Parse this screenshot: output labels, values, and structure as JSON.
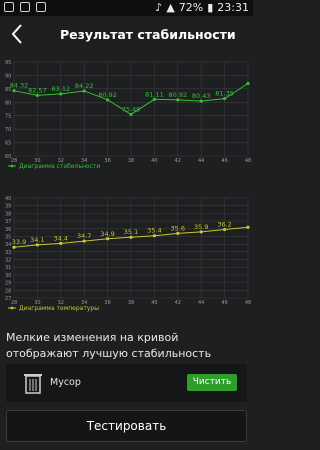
{
  "status_bar": {
    "battery": "72%",
    "time": "23:31"
  },
  "header": {
    "title": "Результат стабильности"
  },
  "stability_chart": {
    "legend": "Диаграмма стабильности",
    "y_ticks": [
      "60",
      "65",
      "70",
      "75",
      "80",
      "85",
      "90",
      "95"
    ],
    "x_ticks": [
      "28",
      "30",
      "32",
      "34",
      "36",
      "38",
      "40",
      "42",
      "44",
      "46",
      "48"
    ]
  },
  "temperature_chart": {
    "legend": "Диаграмма температуры",
    "y_ticks": [
      "27",
      "28",
      "29",
      "30",
      "31",
      "32",
      "33",
      "34",
      "35",
      "36",
      "37",
      "38",
      "39",
      "40"
    ],
    "x_ticks": [
      "28",
      "30",
      "32",
      "34",
      "36",
      "38",
      "40",
      "42",
      "44",
      "46",
      "48"
    ]
  },
  "chart_data": [
    {
      "type": "line",
      "series": [
        {
          "name": "Диаграмма стабильности",
          "color": "#34c134",
          "x": [
            28,
            30,
            32,
            34,
            36,
            38,
            40,
            42,
            44,
            46,
            48
          ],
          "y": [
            84.32,
            82.57,
            83.12,
            84.22,
            80.92,
            75.48,
            81.11,
            80.92,
            80.43,
            81.35,
            87.0
          ]
        }
      ],
      "ylim": [
        60,
        95
      ],
      "xlim": [
        28,
        48
      ],
      "data_labels": [
        "84.32",
        "82.57",
        "83.12",
        "84.22",
        "80.92",
        "75.48",
        "81.11",
        "80.92",
        "80.43",
        "81.35"
      ]
    },
    {
      "type": "line",
      "series": [
        {
          "name": "Диаграмма температуры",
          "color": "#c8c832",
          "x": [
            28,
            30,
            32,
            34,
            36,
            38,
            40,
            42,
            44,
            46,
            48
          ],
          "y": [
            33.6,
            33.9,
            34.1,
            34.4,
            34.7,
            34.9,
            35.1,
            35.4,
            35.6,
            35.9,
            36.2
          ]
        }
      ],
      "ylim": [
        27,
        40
      ],
      "xlim": [
        28,
        48
      ],
      "data_labels": [
        "33.9",
        "34.1",
        "34.4",
        "34.7",
        "34.9",
        "35.1",
        "35.4",
        "35.6",
        "35.9",
        "36.2"
      ]
    }
  ],
  "note": "Мелкие изменения на кривой отображают лучшую стабильность",
  "trash": {
    "label": "Мусор",
    "button": "Чистить"
  },
  "test_button": "Тестировать"
}
